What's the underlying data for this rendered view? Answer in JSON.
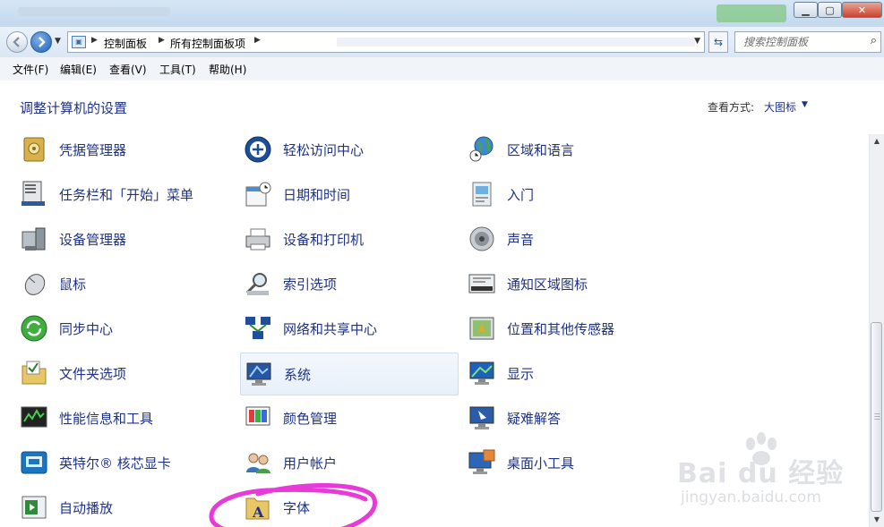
{
  "window": {
    "buttons": {
      "minimize": "▁",
      "maximize": "▢",
      "close": "✕"
    }
  },
  "nav": {
    "breadcrumb": [
      "控制面板",
      "所有控制面板项"
    ],
    "search_placeholder": "搜索控制面板"
  },
  "menu": [
    "文件(F)",
    "编辑(E)",
    "查看(V)",
    "工具(T)",
    "帮助(H)"
  ],
  "header": {
    "title": "调整计算机的设置",
    "view_label": "查看方式:",
    "view_value": "大图标"
  },
  "items": {
    "col1": [
      "凭据管理器",
      "任务栏和「开始」菜单",
      "设备管理器",
      "鼠标",
      "同步中心",
      "文件夹选项",
      "性能信息和工具",
      "英特尔® 核芯显卡",
      "自动播放"
    ],
    "col2": [
      "轻松访问中心",
      "日期和时间",
      "设备和打印机",
      "索引选项",
      "网络和共享中心",
      "系统",
      "颜色管理",
      "用户帐户",
      "字体"
    ],
    "col3": [
      "区域和语言",
      "入门",
      "声音",
      "通知区域图标",
      "位置和其他传感器",
      "显示",
      "疑难解答",
      "桌面小工具"
    ]
  },
  "hovered_item": "系统",
  "annotation_color": "#e83ad8",
  "watermark": {
    "main": "Bai du 经验",
    "sub": "jingyan.baidu.com"
  },
  "colors": {
    "link": "#1e3287",
    "hover_bg": "#e7f0fa"
  }
}
